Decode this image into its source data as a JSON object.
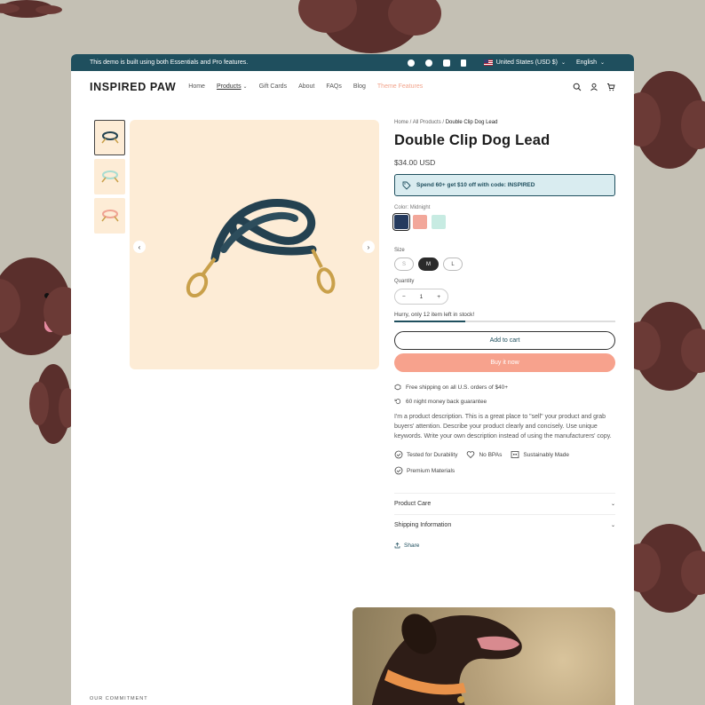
{
  "announcement": {
    "message": "This demo is built using both Essentials and Pro features.",
    "country": "United States (USD $)",
    "language": "English"
  },
  "header": {
    "logo": "INSPIRED PAW",
    "nav": [
      "Home",
      "Products",
      "Gift Cards",
      "About",
      "FAQs",
      "Blog",
      "Theme Features"
    ]
  },
  "breadcrumb": [
    "Home",
    "All Products",
    "Double Clip Dog Lead"
  ],
  "product": {
    "title": "Double Clip Dog Lead",
    "price": "$34.00 USD",
    "promo": "Spend 60+ get $10 off with code: INSPIRED",
    "color_label": "Color:",
    "color_value": "Midnight",
    "colors": [
      "#243a5e",
      "#f2a79a",
      "#c7ebe2"
    ],
    "size_label": "Size",
    "sizes": [
      "S",
      "M",
      "L"
    ],
    "selected_size": "M",
    "quantity_label": "Quantity",
    "quantity": "1",
    "stock_text": "Hurry, only 12 item left in stock!",
    "stock_fraction": 0.32,
    "add_to_cart": "Add to cart",
    "buy_now": "Buy it now",
    "shipping": "Free shipping on all U.S. orders of $40+",
    "guarantee": "60 night money back guarantee",
    "description": "I'm a product description. This is a great place to \"sell\" your product and grab buyers' attention. Describe your product clearly and concisely. Use unique keywords. Write your own description instead of using the manufacturers' copy.",
    "badges": [
      "Tested for Durability",
      "No BPAs",
      "Sustainably Made",
      "Premium Materials"
    ],
    "accordions": [
      "Product Care",
      "Shipping Information"
    ],
    "share": "Share"
  },
  "footer": {
    "commitment": "OUR COMMITMENT"
  },
  "colors": {
    "brand": "#1f4f5e",
    "accent": "#f7a28d",
    "image_bg": "#fdecd6"
  }
}
